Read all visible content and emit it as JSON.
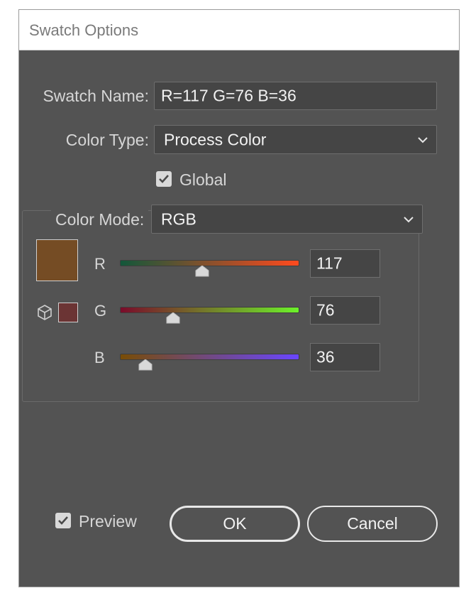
{
  "window": {
    "title": "Swatch Options"
  },
  "form": {
    "swatch_name_label": "Swatch Name:",
    "swatch_name_value": "R=117 G=76 B=36",
    "color_type_label": "Color Type:",
    "color_type_value": "Process Color",
    "global_label": "Global",
    "global_checked": true,
    "color_mode_label": "Color Mode:",
    "color_mode_value": "RGB"
  },
  "swatch": {
    "color": "#754C24",
    "out_of_gamut_color": "#6B3434",
    "out_of_gamut_icon": "cube-icon"
  },
  "channels": [
    {
      "label": "R",
      "value": "117",
      "fraction": 0.459,
      "gradient": [
        "#13573a",
        "#ff4a1e"
      ]
    },
    {
      "label": "G",
      "value": "76",
      "fraction": 0.298,
      "gradient": [
        "#7a0b2a",
        "#6cf22a"
      ]
    },
    {
      "label": "B",
      "value": "36",
      "fraction": 0.141,
      "gradient": [
        "#784c05",
        "#6a46ff"
      ]
    }
  ],
  "footer": {
    "preview_label": "Preview",
    "preview_checked": true,
    "ok_label": "OK",
    "cancel_label": "Cancel"
  }
}
